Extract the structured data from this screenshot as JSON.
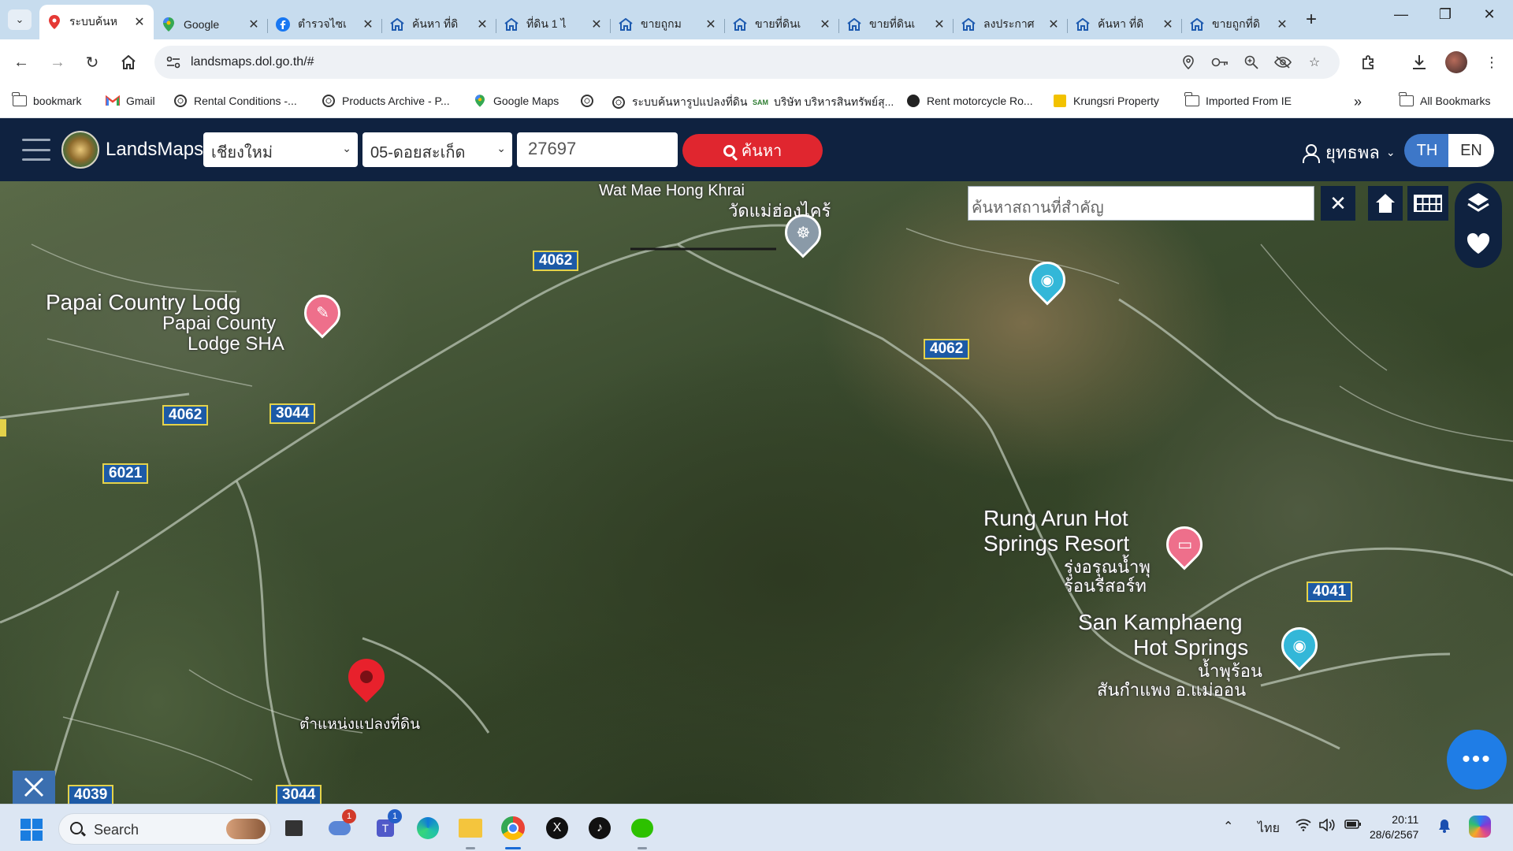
{
  "browser": {
    "tabs": [
      {
        "title": "ระบบค้นห",
        "favicon": "map-pin-icon",
        "active": true
      },
      {
        "title": "Google",
        "favicon": "google-maps-icon"
      },
      {
        "title": "ตำรวจไซเ",
        "favicon": "facebook-icon"
      },
      {
        "title": "ค้นหา ที่ดิ",
        "favicon": "dol-home-icon"
      },
      {
        "title": "ที่ดิน 1 ไ",
        "favicon": "dol-home-icon"
      },
      {
        "title": "ขายถูกม",
        "favicon": "dol-home-icon"
      },
      {
        "title": "ขายที่ดินเ",
        "favicon": "dol-home-icon"
      },
      {
        "title": "ขายที่ดินเ",
        "favicon": "dol-home-icon"
      },
      {
        "title": "ลงประกาศ",
        "favicon": "dol-home-icon"
      },
      {
        "title": "ค้นหา ที่ดิ",
        "favicon": "dol-home-icon"
      },
      {
        "title": "ขายถูกที่ดิ",
        "favicon": "dol-home-icon"
      }
    ],
    "new_tab_label": "+",
    "url": "landsmaps.dol.go.th/#",
    "bookmarks": [
      {
        "label": "bookmark",
        "icon": "folder-icon"
      },
      {
        "label": "Gmail",
        "icon": "gmail-icon"
      },
      {
        "label": "Rental Conditions -...",
        "icon": "globe-icon"
      },
      {
        "label": "Products Archive - P...",
        "icon": "globe-icon"
      },
      {
        "label": "Google Maps",
        "icon": "google-maps-icon"
      },
      {
        "label": "",
        "icon": "globe-icon"
      },
      {
        "label": "ระบบค้นหารูปแปลงที่ดิน",
        "icon": "globe-icon"
      },
      {
        "label": "บริษัท บริหารสินทรัพย์สุ...",
        "icon": "sam-icon"
      },
      {
        "label": "Rent motorcycle Ro...",
        "icon": "motorcycle-icon"
      },
      {
        "label": "Krungsri Property",
        "icon": "krungsri-icon"
      },
      {
        "label": "Imported From IE",
        "icon": "folder-icon"
      }
    ],
    "bookmarks_overflow": "»",
    "all_bookmarks_label": "All Bookmarks"
  },
  "landsmaps": {
    "brand": "LandsMaps",
    "province": "เชียงใหม่",
    "district": "05-ดอยสะเก็ด",
    "parcel_number": "27697",
    "search_label": "ค้นหา",
    "user_name": "ยุทธพล",
    "lang_th": "TH",
    "lang_en": "EN",
    "map_search_placeholder": "ค้นหาสถานที่สำคัญ",
    "clear_label": "✕",
    "chat_label": "•••"
  },
  "map": {
    "place_labels": {
      "temple_name": "วัดแม่ฮ่องไคร้",
      "temple_name_en": "Wat Mae Hong Khrai",
      "papai_1": "Papai Country Lodg",
      "papai_2": "Papai Count",
      "papai_2b": "y",
      "papai_3": "Lodge SH",
      "papai_3b": "A",
      "rung_1": "Rung Arun Hot",
      "rung_2": "Springs Resort",
      "rung_th_1": "รุ่งอรุณน้ำพุ",
      "rung_th_2": "ร้อนรีสอร์ท",
      "san_1": "San Kamphaeng",
      "san_2": "Hot Springs",
      "san_th_1": "น้ำพุร้อน",
      "san_th_2": "สันกำแพง อ.แม่ออน",
      "land_position": "ตำแหน่งแปลงที่ดิน"
    },
    "road_labels": [
      "4062",
      "4062",
      "4062",
      "3044",
      "6021",
      "4041",
      "4039",
      "3044"
    ]
  },
  "taskbar": {
    "search_label": "Search",
    "apps": [
      {
        "name": "task-view-icon"
      },
      {
        "name": "weather-app-icon",
        "badge": "1"
      },
      {
        "name": "teams-icon",
        "badge": "1"
      },
      {
        "name": "edge-icon"
      },
      {
        "name": "file-explorer-icon"
      },
      {
        "name": "chrome-icon"
      },
      {
        "name": "x-icon"
      },
      {
        "name": "tiktok-icon"
      },
      {
        "name": "wechat-icon"
      }
    ],
    "language": "ไทย",
    "time": "20:11",
    "date": "28/6/2567"
  }
}
